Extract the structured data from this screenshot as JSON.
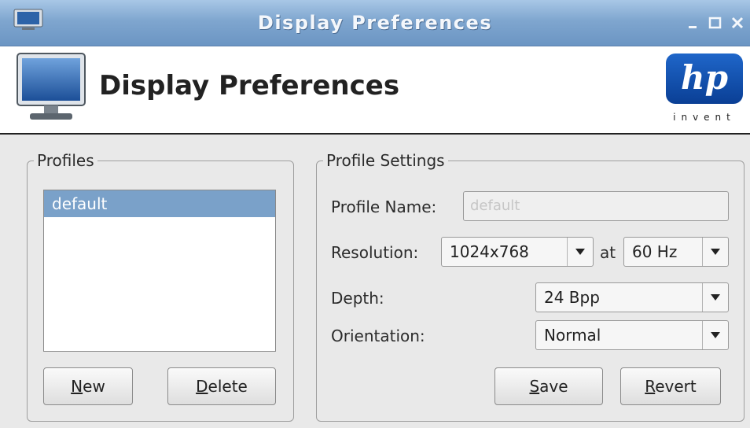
{
  "window": {
    "title": "Display Preferences",
    "controls": {
      "minimize_icon": "minimize-icon",
      "maximize_icon": "maximize-icon",
      "close_icon": "close-icon"
    }
  },
  "header": {
    "title": "Display Preferences",
    "logo": {
      "brand": "hp",
      "tagline": "invent"
    }
  },
  "profiles": {
    "legend": "Profiles",
    "items": [
      {
        "label": "default",
        "selected": true
      }
    ],
    "new_button": {
      "mnemonic": "N",
      "rest": "ew"
    },
    "delete_button": {
      "mnemonic": "D",
      "rest": "elete"
    }
  },
  "settings": {
    "legend": "Profile Settings",
    "profile_name": {
      "label": "Profile Name:",
      "value": "default"
    },
    "resolution": {
      "label": "Resolution:",
      "value": "1024x768",
      "at_label": "at",
      "rate": "60 Hz"
    },
    "depth": {
      "label": "Depth:",
      "value": "24 Bpp"
    },
    "orientation": {
      "label": "Orientation:",
      "value": "Normal"
    },
    "save_button": {
      "mnemonic": "S",
      "rest": "ave"
    },
    "revert_button": {
      "mnemonic": "R",
      "rest": "evert"
    }
  },
  "colors": {
    "titlebar": "#7fa6cf",
    "selection": "#7aa1c9",
    "hp_blue": "#0a3f95"
  }
}
